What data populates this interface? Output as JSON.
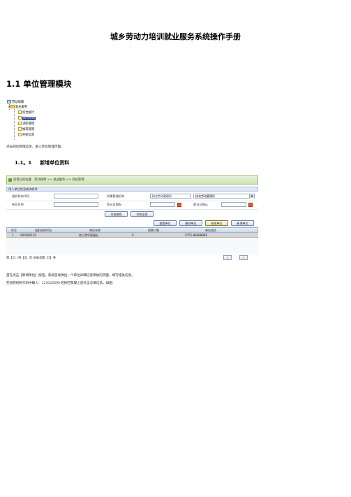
{
  "document": {
    "title": "城乡劳动力培训就业服务系统操作手册",
    "section_heading": "1.1 单位管理模块",
    "para_intro": "点击岗位管理菜单，进入单位管理页面。",
    "subsection_num": "1.1。1",
    "subsection_title": "新增单位资料",
    "para_after_1": "首先点击【新增单位】按钮，系统自动弹出一个单位详细信息添加的页面，填写相关信息。",
    "para_after_2": "在组织机构代码中输入：123025690 后按回车键之后补全必填信息，如图："
  },
  "tree": {
    "root": "劳动保障",
    "folder": "就业服务",
    "items": [
      "综合统计",
      "岗位管理",
      "求职管理",
      "推荐反馈",
      "开始信息"
    ],
    "selected_index": 1
  },
  "app": {
    "breadcrumb": "您现在的位置：劳动保障 >> 就业服务 >> 岗位管理",
    "query_panel_title": "用人单位信息查询条件",
    "fields": {
      "org_code_label": "组织机构代码",
      "belong_org_label": "所属管理机构",
      "belong_org_value": "核北劳动管理所",
      "belong_org_select": "核北劳动管理所",
      "unit_name_label": "单位名称",
      "reg_date_start_label": "登记日期起",
      "reg_date_end_label": "登记日期止"
    },
    "buttons": {
      "search": "开始查找",
      "show_all": "浏览全部",
      "view_unit": "查看单位",
      "delete_unit": "删除单位",
      "modify_unit": "修改单位",
      "add_unit": "新增单位"
    },
    "grid": {
      "columns": [
        "序号",
        "组织机构代码",
        "单位名称",
        "招聘人数",
        "单位电话"
      ],
      "rows": [
        [
          "1",
          "080080139",
          "农行滑华营服社",
          "0",
          "0755-88888888"
        ]
      ]
    },
    "pager": "第【1】/共【1】页 记录总数【1】条",
    "pager_prev": "<",
    "pager_next": ">"
  }
}
